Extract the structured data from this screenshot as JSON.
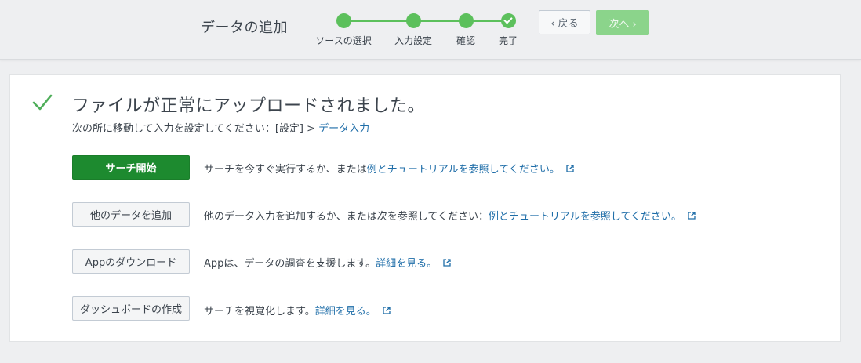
{
  "header": {
    "title": "データの追加",
    "steps": [
      {
        "label": "ソースの選択",
        "state": "complete"
      },
      {
        "label": "入力設定",
        "state": "complete"
      },
      {
        "label": "確認",
        "state": "complete"
      },
      {
        "label": "完了",
        "state": "done"
      }
    ],
    "back_label": "‹ 戻る",
    "next_label": "次へ ›",
    "accent_color": "#5cc05c"
  },
  "main": {
    "success_title": "ファイルが正常にアップロードされました。",
    "subline_prefix": "次の所に移動して入力を設定してください：[設定] > ",
    "subline_link": "データ入力",
    "actions": [
      {
        "button": "サーチ開始",
        "text": "サーチを今すぐ実行するか、または ",
        "link": "例とチュートリアルを参照してください。",
        "style": "primary"
      },
      {
        "button": "他のデータを追加",
        "text": "他のデータ入力を追加するか、または次を参照してください： ",
        "link": "例とチュートリアルを参照してください。",
        "style": "secondary"
      },
      {
        "button": "Appのダウンロード",
        "text": "Appは、データの調査を支援します。 ",
        "link": "詳細を見る。",
        "style": "secondary"
      },
      {
        "button": "ダッシュボードの作成",
        "text": "サーチを視覚化します。 ",
        "link": "詳細を見る。",
        "style": "secondary"
      }
    ]
  }
}
